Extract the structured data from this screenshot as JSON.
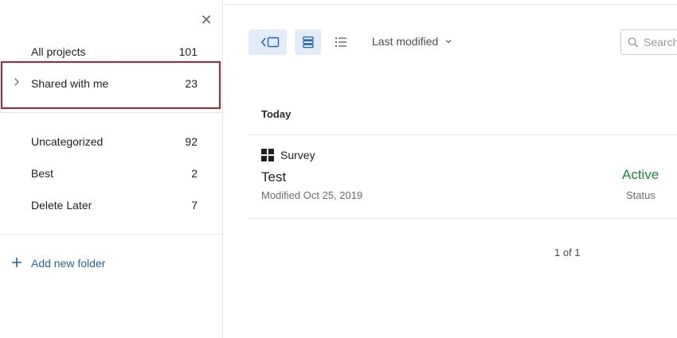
{
  "sidebar": {
    "close_icon": "close-icon",
    "primary_folders": [
      {
        "label": "All projects",
        "count": "101"
      },
      {
        "label": "Shared with me",
        "count": "23"
      }
    ],
    "user_folders": [
      {
        "label": "Uncategorized",
        "count": "92"
      },
      {
        "label": "Best",
        "count": "2"
      },
      {
        "label": "Delete Later",
        "count": "7"
      }
    ],
    "add_folder_label": "Add new folder",
    "highlight_color": "#b5222d"
  },
  "toolbar": {
    "sort_label": "Last modified",
    "search_placeholder": "Search"
  },
  "list": {
    "section_title": "Today",
    "projects": [
      {
        "type": "Survey",
        "name": "Test",
        "modified": "Modified Oct 25, 2019",
        "status": "Active",
        "status_label": "Status"
      }
    ],
    "pagination": "1 of 1"
  },
  "colors": {
    "accent": "#1e63c4",
    "active_status": "#148a3a",
    "active_view_bg": "#e2ecf8"
  }
}
